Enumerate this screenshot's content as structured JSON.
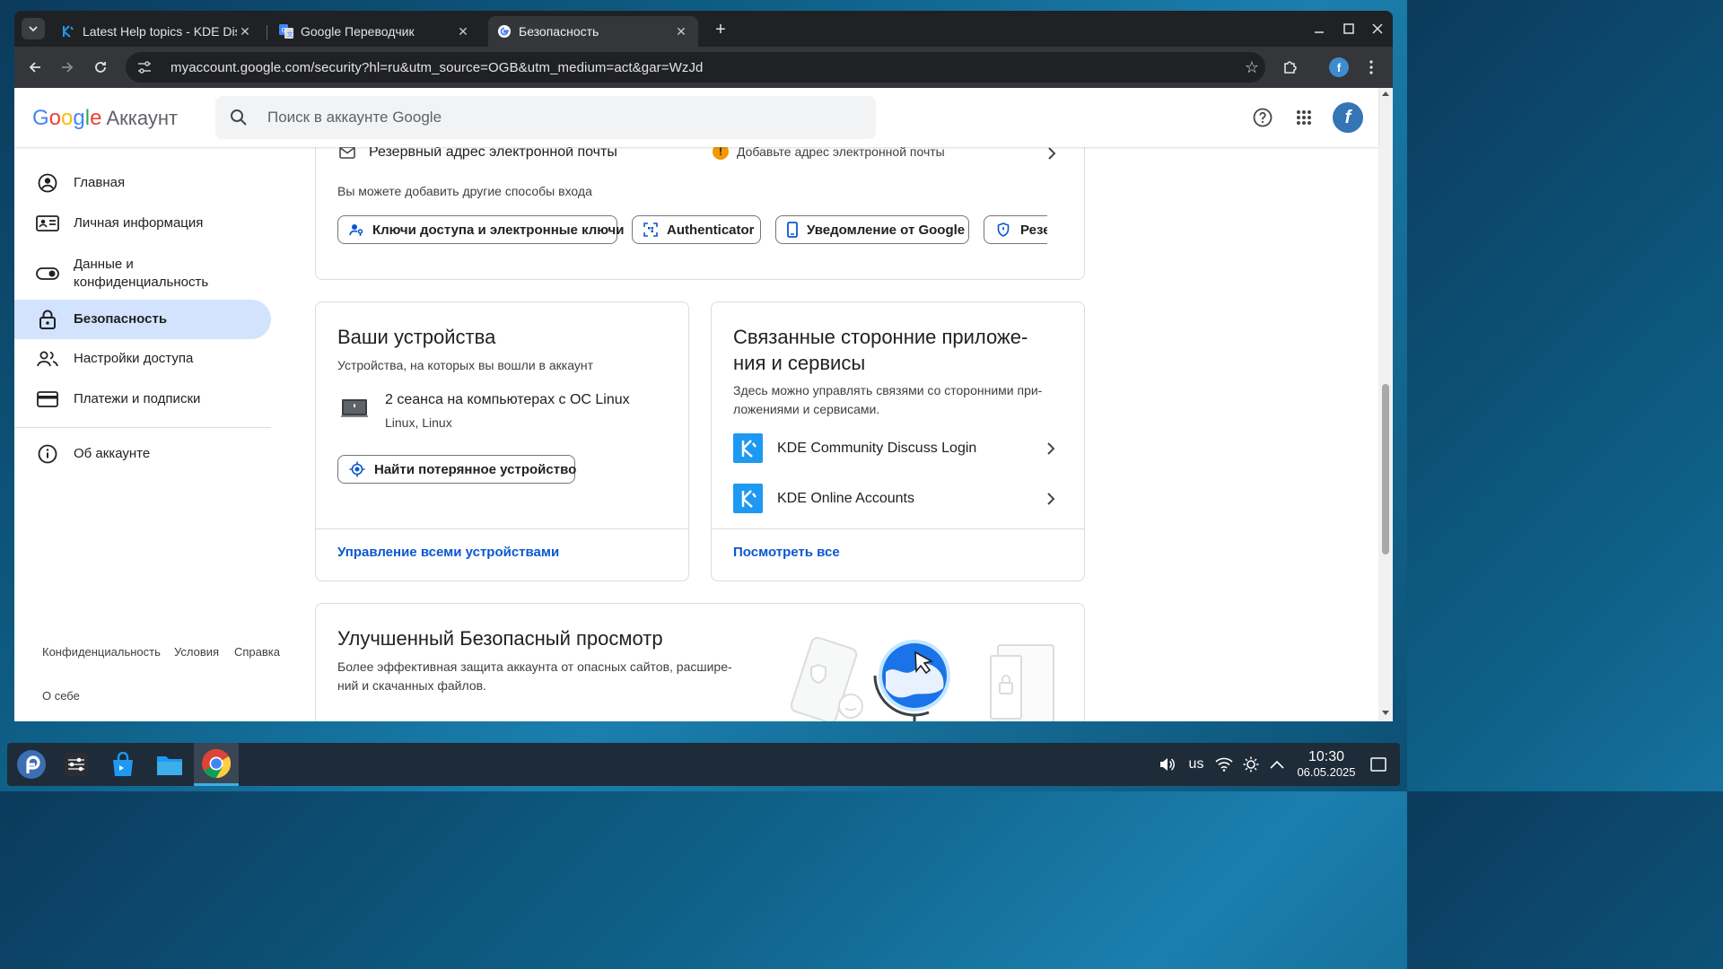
{
  "browser": {
    "tabs": [
      {
        "title": "Latest Help topics - KDE Dis",
        "icon": "kde-icon"
      },
      {
        "title": "Google Переводчик",
        "icon": "google-translate-icon"
      },
      {
        "title": "Безопасность",
        "icon": "google-icon"
      }
    ],
    "active_tab_index": 2,
    "url": "myaccount.google.com/security?hl=ru&utm_source=OGB&utm_medium=act&gar=WzJd"
  },
  "header": {
    "logo_text": "Google",
    "product_name": "Аккаунт",
    "search_placeholder": "Поиск в аккаунте Google",
    "avatar_letter": "f"
  },
  "sidebar": {
    "items": [
      {
        "label": "Главная",
        "icon": "account-circle-icon"
      },
      {
        "label": "Личная информация",
        "icon": "id-card-icon"
      },
      {
        "label": "Данные и конфиденциальность",
        "icon": "toggle-icon"
      },
      {
        "label": "Безопасность",
        "icon": "lock-icon",
        "active": true
      },
      {
        "label": "Настройки доступа",
        "icon": "people-icon"
      },
      {
        "label": "Платежи и подписки",
        "icon": "credit-card-icon"
      }
    ],
    "about": {
      "label": "Об аккаунте",
      "icon": "info-icon"
    },
    "footer": {
      "privacy": "Конфиденциальность",
      "terms": "Условия",
      "help": "Справка",
      "about": "О себе"
    }
  },
  "signin_card": {
    "recovery_email_label": "Резервный адрес электронной почты",
    "recovery_email_status": "Добавьте адрес электронной почты",
    "other_methods_text": "Вы можете добавить другие способы входа",
    "chips": [
      {
        "label": "Ключи доступа и электронные ключи",
        "icon": "passkey-icon"
      },
      {
        "label": "Authenticator",
        "icon": "authenticator-icon"
      },
      {
        "label": "Уведомление от Google",
        "icon": "phone-icon"
      },
      {
        "label": "Резер",
        "icon": "shield-icon"
      }
    ]
  },
  "devices_card": {
    "title": "Ваши устройства",
    "subtitle": "Устройства, на которых вы вошли в аккаунт",
    "session_title": "2 сеанса на компьютерах с ОС Linux",
    "session_sub": "Linux, Linux",
    "find_button": "Найти потерянное устройство",
    "manage_link": "Управление всеми устройствами"
  },
  "apps_card": {
    "title_line1": "Связанные сторонние приложе-",
    "title_line2": "ния и сервисы",
    "desc_line1": "Здесь можно управлять связями со сторонними при-",
    "desc_line2": "ложениями и сервисами.",
    "apps": [
      {
        "name": "KDE Community Discuss Login"
      },
      {
        "name": "KDE Online Accounts"
      }
    ],
    "see_all": "Посмотреть все"
  },
  "safe_browsing_card": {
    "title": "Улучшенный Безопасный просмотр",
    "desc_line1": "Более эффективная защита аккаунта от опасных сайтов, расшире-",
    "desc_line2": "ний и скачанных файлов."
  },
  "taskbar": {
    "apps": [
      "fedora-launcher-icon",
      "system-settings-icon",
      "discover-icon",
      "dolphin-icon",
      "chrome-icon"
    ],
    "keyboard_layout": "us",
    "time": "10:30",
    "date": "06.05.2025"
  },
  "colors": {
    "google_blue": "#4285F4",
    "google_red": "#EA4335",
    "google_yellow": "#FBBC05",
    "google_green": "#34A853",
    "active_nav_bg": "#d3e3fd",
    "link_blue": "#0b57d0",
    "kde_blue": "#1d99f3"
  }
}
